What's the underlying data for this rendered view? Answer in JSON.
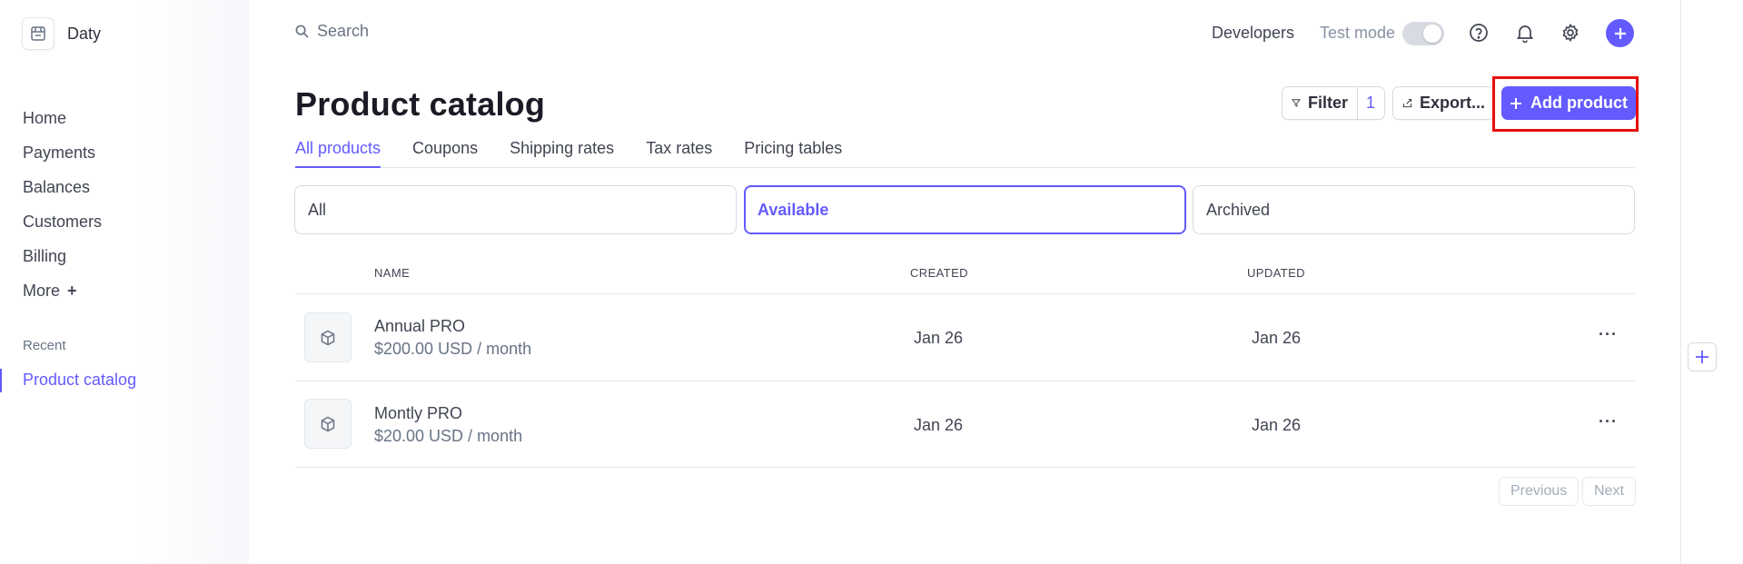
{
  "account": {
    "name": "Daty"
  },
  "sidebar": {
    "items": [
      {
        "label": "Home"
      },
      {
        "label": "Payments"
      },
      {
        "label": "Balances"
      },
      {
        "label": "Customers"
      },
      {
        "label": "Billing"
      },
      {
        "label": "More",
        "suffix": "+"
      }
    ],
    "recent_label": "Recent",
    "recent_items": [
      {
        "label": "Product catalog"
      }
    ]
  },
  "topbar": {
    "search_placeholder": "Search",
    "developers": "Developers",
    "test_mode": "Test mode",
    "test_mode_on": false
  },
  "header": {
    "title": "Product catalog",
    "filter_label": "Filter",
    "filter_count": "1",
    "export_label": "Export...",
    "add_label": "Add product"
  },
  "tabs": [
    {
      "label": "All products",
      "active": true
    },
    {
      "label": "Coupons"
    },
    {
      "label": "Shipping rates"
    },
    {
      "label": "Tax rates"
    },
    {
      "label": "Pricing tables"
    }
  ],
  "status_filters": [
    {
      "label": "All"
    },
    {
      "label": "Available",
      "active": true
    },
    {
      "label": "Archived"
    }
  ],
  "table": {
    "columns": {
      "name": "NAME",
      "created": "CREATED",
      "updated": "UPDATED"
    },
    "rows": [
      {
        "name": "Annual PRO",
        "price": "$200.00 USD / month",
        "created": "Jan 26",
        "updated": "Jan 26"
      },
      {
        "name": "Montly PRO",
        "price": "$20.00 USD / month",
        "created": "Jan 26",
        "updated": "Jan 26"
      }
    ]
  },
  "pagination": {
    "previous": "Previous",
    "next": "Next"
  },
  "colors": {
    "accent": "#635bff",
    "highlight": "#e80d0d"
  }
}
